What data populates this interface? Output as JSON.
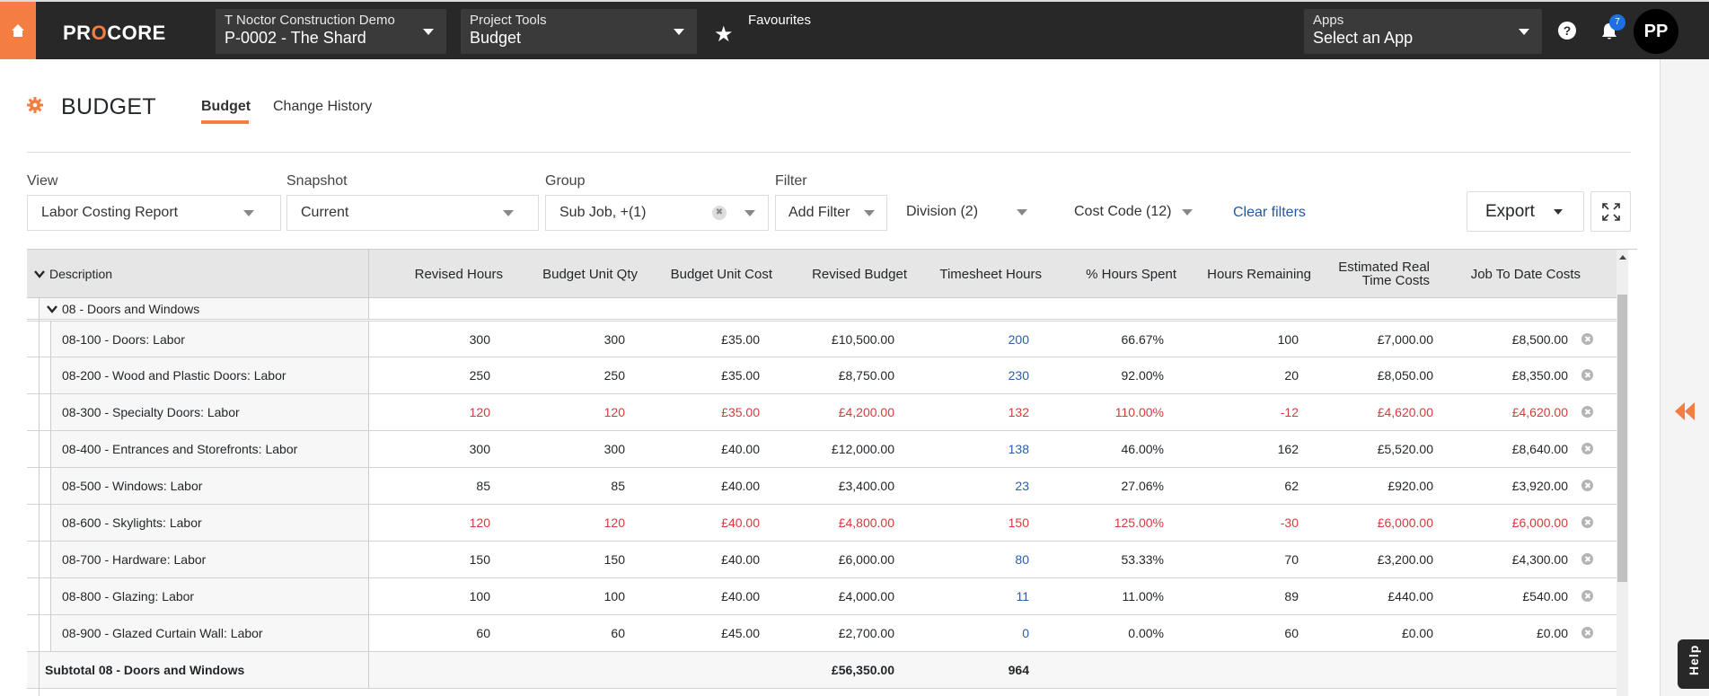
{
  "topbar": {
    "logo": "PROCORE",
    "company": {
      "label": "T Noctor Construction Demo",
      "value": "P-0002 - The Shard"
    },
    "tools": {
      "label": "Project Tools",
      "value": "Budget"
    },
    "favourites": "Favourites",
    "apps": {
      "label": "Apps",
      "value": "Select an App"
    },
    "help_glyph": "?",
    "notifications_count": "7",
    "avatar_initials": "PP",
    "brand_color": "#f47e42"
  },
  "page": {
    "title": "BUDGET",
    "tabs": [
      {
        "label": "Budget",
        "active": true
      },
      {
        "label": "Change History",
        "active": false
      }
    ]
  },
  "filters": {
    "view": {
      "label": "View",
      "value": "Labor Costing Report"
    },
    "snapshot": {
      "label": "Snapshot",
      "value": "Current"
    },
    "group": {
      "label": "Group",
      "value": "Sub Job, +(1)"
    },
    "filter": {
      "label": "Filter",
      "add": "Add Filter",
      "division": "Division (2)",
      "cost_code": "Cost Code (12)"
    },
    "clear": "Clear filters",
    "export": "Export"
  },
  "table": {
    "columns": [
      "Description",
      "Revised Hours",
      "Budget Unit Qty",
      "Budget Unit Cost",
      "Revised Budget",
      "Timesheet Hours",
      "% Hours Spent",
      "Hours Remaining",
      "Estimated Real Time Costs",
      "Job To Date Costs"
    ],
    "group_label": "08 - Doors and Windows",
    "rows": [
      {
        "desc": "08-100 - Doors: Labor",
        "revised_hours": "300",
        "unit_qty": "300",
        "unit_cost": "£35.00",
        "revised_budget": "£10,500.00",
        "timesheet_hours": "200",
        "pct_spent": "66.67%",
        "hours_remaining": "100",
        "est_cost": "£7,000.00",
        "jtd_cost": "£8,500.00",
        "over": false
      },
      {
        "desc": "08-200 - Wood and Plastic Doors: Labor",
        "revised_hours": "250",
        "unit_qty": "250",
        "unit_cost": "£35.00",
        "revised_budget": "£8,750.00",
        "timesheet_hours": "230",
        "pct_spent": "92.00%",
        "hours_remaining": "20",
        "est_cost": "£8,050.00",
        "jtd_cost": "£8,350.00",
        "over": false
      },
      {
        "desc": "08-300 - Specialty Doors: Labor",
        "revised_hours": "120",
        "unit_qty": "120",
        "unit_cost": "£35.00",
        "revised_budget": "£4,200.00",
        "timesheet_hours": "132",
        "pct_spent": "110.00%",
        "hours_remaining": "-12",
        "est_cost": "£4,620.00",
        "jtd_cost": "£4,620.00",
        "over": true
      },
      {
        "desc": "08-400 - Entrances and Storefronts: Labor",
        "revised_hours": "300",
        "unit_qty": "300",
        "unit_cost": "£40.00",
        "revised_budget": "£12,000.00",
        "timesheet_hours": "138",
        "pct_spent": "46.00%",
        "hours_remaining": "162",
        "est_cost": "£5,520.00",
        "jtd_cost": "£8,640.00",
        "over": false
      },
      {
        "desc": "08-500 - Windows: Labor",
        "revised_hours": "85",
        "unit_qty": "85",
        "unit_cost": "£40.00",
        "revised_budget": "£3,400.00",
        "timesheet_hours": "23",
        "pct_spent": "27.06%",
        "hours_remaining": "62",
        "est_cost": "£920.00",
        "jtd_cost": "£3,920.00",
        "over": false
      },
      {
        "desc": "08-600 - Skylights: Labor",
        "revised_hours": "120",
        "unit_qty": "120",
        "unit_cost": "£40.00",
        "revised_budget": "£4,800.00",
        "timesheet_hours": "150",
        "pct_spent": "125.00%",
        "hours_remaining": "-30",
        "est_cost": "£6,000.00",
        "jtd_cost": "£6,000.00",
        "over": true
      },
      {
        "desc": "08-700 - Hardware: Labor",
        "revised_hours": "150",
        "unit_qty": "150",
        "unit_cost": "£40.00",
        "revised_budget": "£6,000.00",
        "timesheet_hours": "80",
        "pct_spent": "53.33%",
        "hours_remaining": "70",
        "est_cost": "£3,200.00",
        "jtd_cost": "£4,300.00",
        "over": false
      },
      {
        "desc": "08-800 - Glazing: Labor",
        "revised_hours": "100",
        "unit_qty": "100",
        "unit_cost": "£40.00",
        "revised_budget": "£4,000.00",
        "timesheet_hours": "11",
        "pct_spent": "11.00%",
        "hours_remaining": "89",
        "est_cost": "£440.00",
        "jtd_cost": "£540.00",
        "over": false
      },
      {
        "desc": "08-900 - Glazed Curtain Wall: Labor",
        "revised_hours": "60",
        "unit_qty": "60",
        "unit_cost": "£45.00",
        "revised_budget": "£2,700.00",
        "timesheet_hours": "0",
        "pct_spent": "0.00%",
        "hours_remaining": "60",
        "est_cost": "£0.00",
        "jtd_cost": "£0.00",
        "over": false
      }
    ],
    "subtotal": {
      "label": "Subtotal 08 - Doors and Windows",
      "revised_budget": "£56,350.00",
      "timesheet_hours": "964"
    }
  },
  "side": {
    "help_label": "Help"
  }
}
